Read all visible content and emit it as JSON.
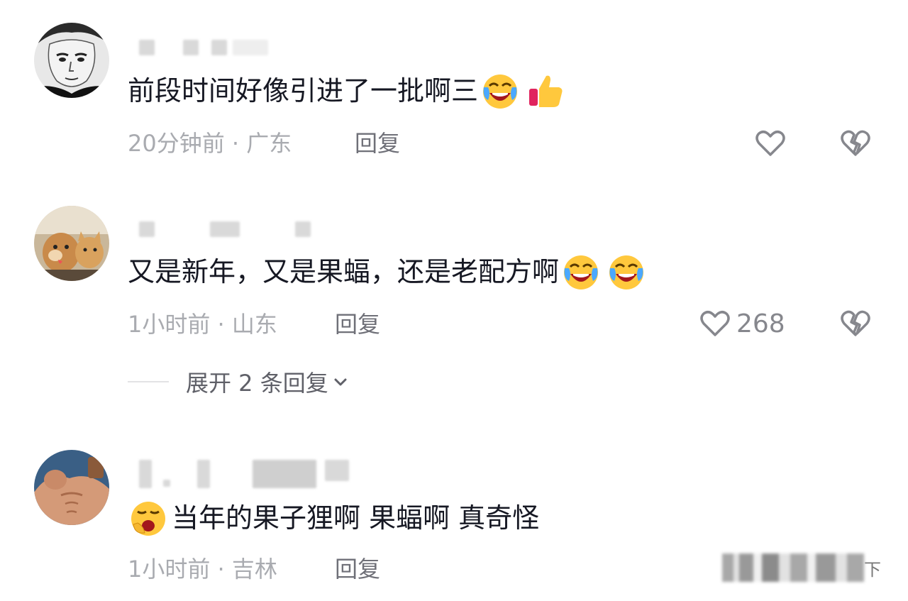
{
  "comments": [
    {
      "text": "前段时间好像引进了一批啊三",
      "time": "20分钟前",
      "location": "广东",
      "reply_label": "回复",
      "emojis": [
        "crying-laughing-emoji",
        "thumbs-up-emoji"
      ],
      "avatar": "anime-face-avatar"
    },
    {
      "text": "又是新年，又是果蝠，还是老配方啊",
      "time": "1小时前",
      "location": "山东",
      "reply_label": "回复",
      "like_count": "268",
      "emojis": [
        "crying-laughing-emoji",
        "crying-laughing-emoji"
      ],
      "avatar": "dog-and-cat-avatar"
    },
    {
      "text": "当年的果子狸啊 果蝠啊 真奇怪",
      "time": "1小时前",
      "location": "吉林",
      "reply_label": "回复",
      "emojis": [
        "yawning-emoji"
      ],
      "avatar": "muscular-man-avatar"
    }
  ],
  "expand_replies": "展开 2 条回复",
  "meta_separator": "·",
  "watermark_suffix": "下",
  "colors": {
    "text_primary": "#161823",
    "text_meta": "#a9abb0",
    "icon_gray": "#86878d",
    "emoji_yellow": "#FFC83D"
  }
}
